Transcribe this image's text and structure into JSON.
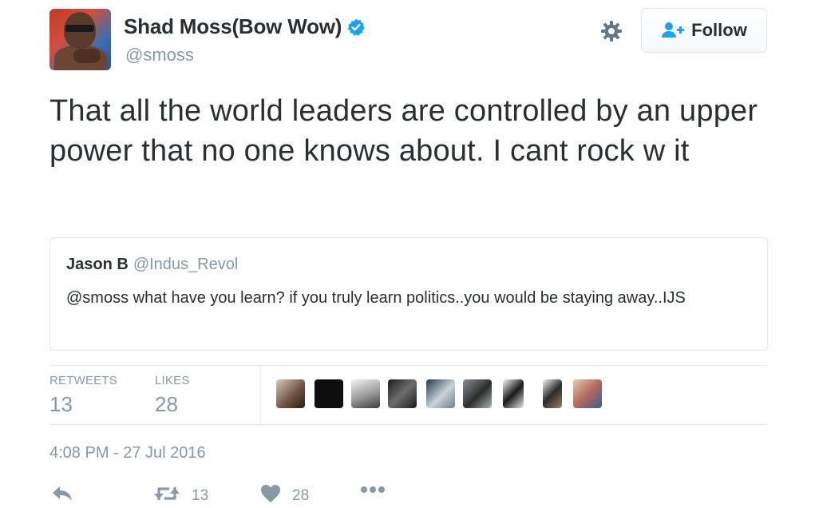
{
  "user": {
    "display_name": "Shad Moss(Bow Wow)",
    "handle": "@smoss",
    "verified": true,
    "follow_label": "Follow"
  },
  "tweet": {
    "text": "That all the world leaders are controlled by an upper power that no one knows about. I cant rock w it",
    "timestamp": "4:08 PM - 27 Jul 2016"
  },
  "quoted_tweet": {
    "name": "Jason B",
    "handle": "@Indus_Revol",
    "text": "@smoss what have you learn? if you truly learn politics..you would be staying away..IJS"
  },
  "stats": {
    "retweets_label": "RETWEETS",
    "retweets_value": "13",
    "likes_label": "LIKES",
    "likes_value": "28"
  },
  "actions": {
    "reply_icon": "reply-icon",
    "retweet_icon": "retweet-icon",
    "retweet_count": "13",
    "like_icon": "heart-icon",
    "like_count": "28",
    "more_icon": "more-icon"
  },
  "colors": {
    "accent": "#1da1f2",
    "secondary_text": "#8899a6",
    "primary_text": "#292f33",
    "border": "#e1e8ed"
  }
}
